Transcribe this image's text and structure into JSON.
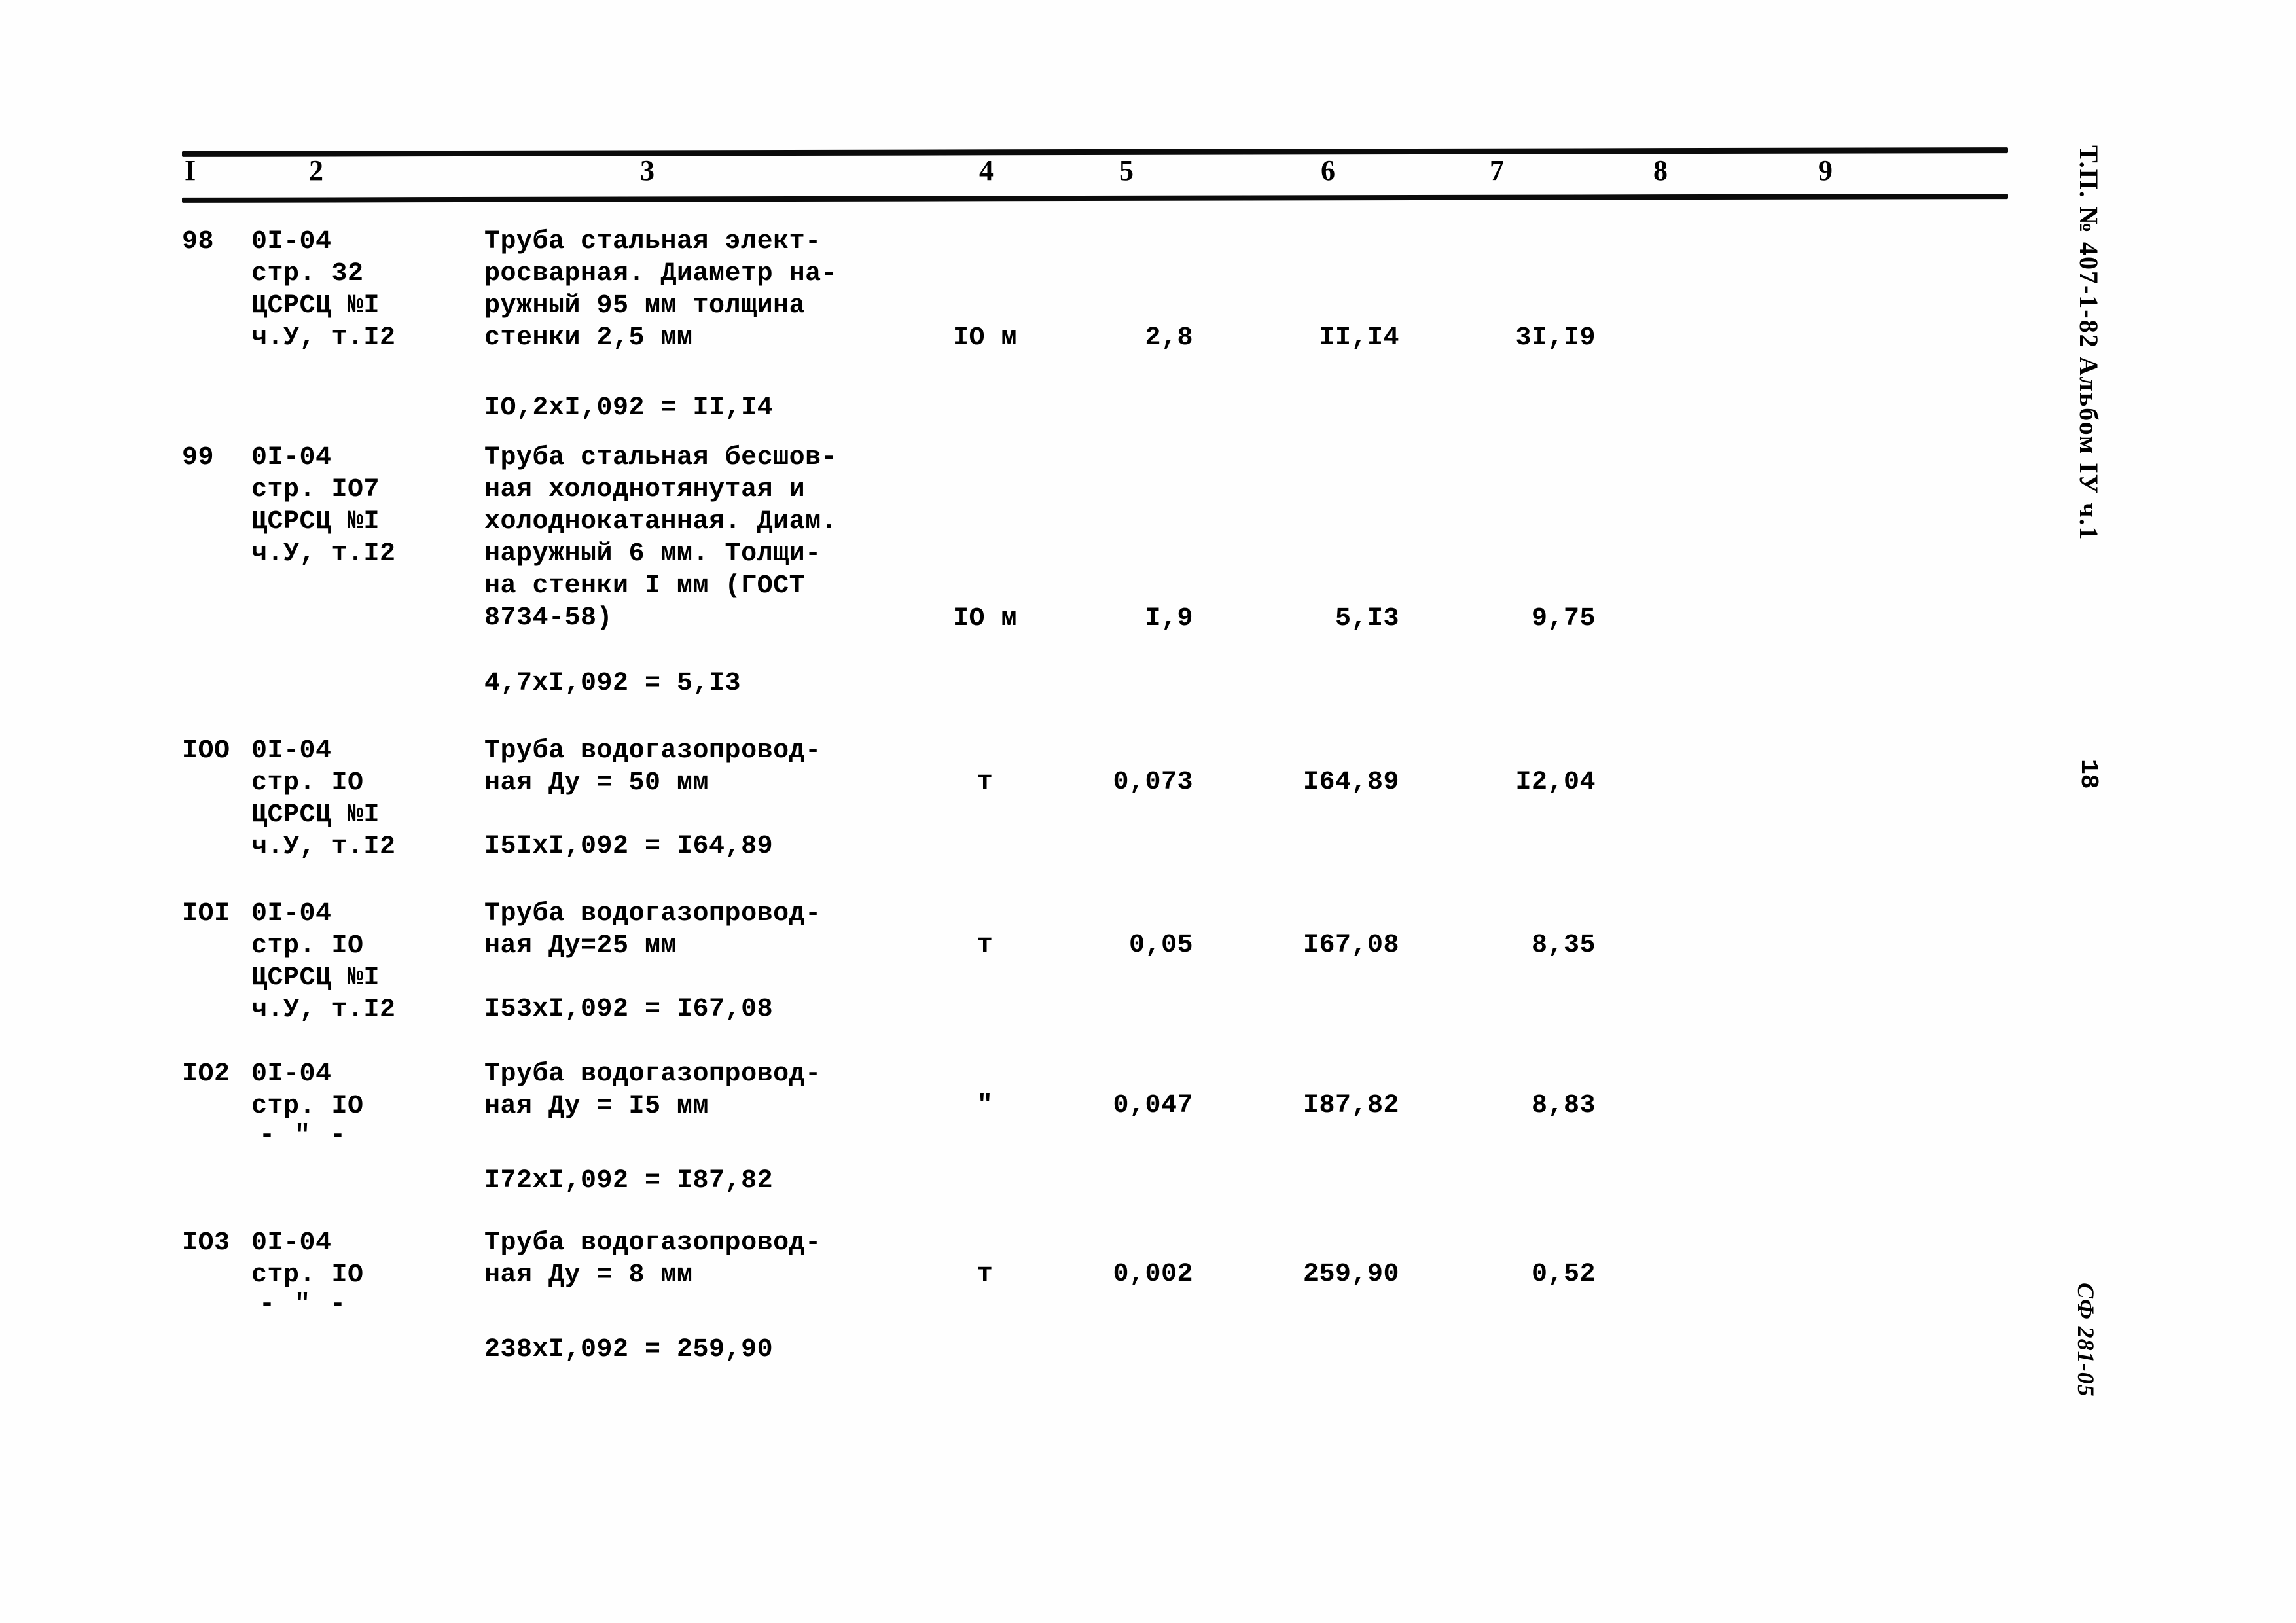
{
  "document": {
    "margin_reference": "Т.П. № 407-1-82 Альбом IУ ч.1",
    "page_number": "18",
    "archive_stamp": "СФ 281-05"
  },
  "table": {
    "column_headers": [
      "I",
      "2",
      "3",
      "4",
      "5",
      "6",
      "7",
      "8",
      "9"
    ],
    "rows": [
      {
        "pos": "98",
        "code_lines": [
          "0I-04",
          "стр. 32",
          "ЦСРСЦ №I",
          "ч.У, т.I2"
        ],
        "desc_lines": [
          "Труба стальная элект-",
          "росварная. Диаметр на-",
          "ружный 95 мм толщина",
          "стенки 2,5 мм"
        ],
        "unit": "IO м",
        "qty": "2,8",
        "price": "II,I4",
        "total": "3I,I9",
        "calc": "IO,2xI,092 = II,I4",
        "ditto": ""
      },
      {
        "pos": "99",
        "code_lines": [
          "0I-04",
          "стр. IO7",
          "ЦСРСЦ №I",
          "ч.У, т.I2"
        ],
        "desc_lines": [
          "Труба стальная бесшов-",
          "ная холоднотянутая и",
          "холоднокатанная. Диам.",
          "наружный 6 мм. Толщи-",
          "на стенки I мм (ГОСТ",
          "8734-58)"
        ],
        "unit": "IO м",
        "qty": "I,9",
        "price": "5,I3",
        "total": "9,75",
        "calc": "4,7xI,092 = 5,I3",
        "ditto": ""
      },
      {
        "pos": "IOO",
        "code_lines": [
          "0I-04",
          "стр. IO",
          "ЦСРСЦ №I",
          "ч.У, т.I2"
        ],
        "desc_lines": [
          "Труба водогазопровод-",
          "ная Ду = 50 мм"
        ],
        "unit": "т",
        "qty": "0,073",
        "price": "I64,89",
        "total": "I2,04",
        "calc": "I5IxI,092 = I64,89",
        "ditto": ""
      },
      {
        "pos": "IOI",
        "code_lines": [
          "0I-04",
          "стр. IO",
          "ЦСРСЦ №I",
          "ч.У, т.I2"
        ],
        "desc_lines": [
          "Труба водогазопровод-",
          "ная Ду=25 мм"
        ],
        "unit": "т",
        "qty": "0,05",
        "price": "I67,08",
        "total": "8,35",
        "calc": "I53xI,092 = I67,08",
        "ditto": ""
      },
      {
        "pos": "IO2",
        "code_lines": [
          "0I-04",
          "стр. IO"
        ],
        "desc_lines": [
          "Труба водогазопровод-",
          "ная Ду = I5 мм"
        ],
        "unit": "\"",
        "qty": "0,047",
        "price": "I87,82",
        "total": "8,83",
        "calc": "I72xI,092 = I87,82",
        "ditto": "- \" -"
      },
      {
        "pos": "IO3",
        "code_lines": [
          "0I-04",
          "стр. IO"
        ],
        "desc_lines": [
          "Труба водогазопровод-",
          "ная Ду = 8 мм"
        ],
        "unit": "т",
        "qty": "0,002",
        "price": "259,90",
        "total": "0,52",
        "calc": "238xI,092 = 259,90",
        "ditto": "- \" -"
      }
    ]
  }
}
